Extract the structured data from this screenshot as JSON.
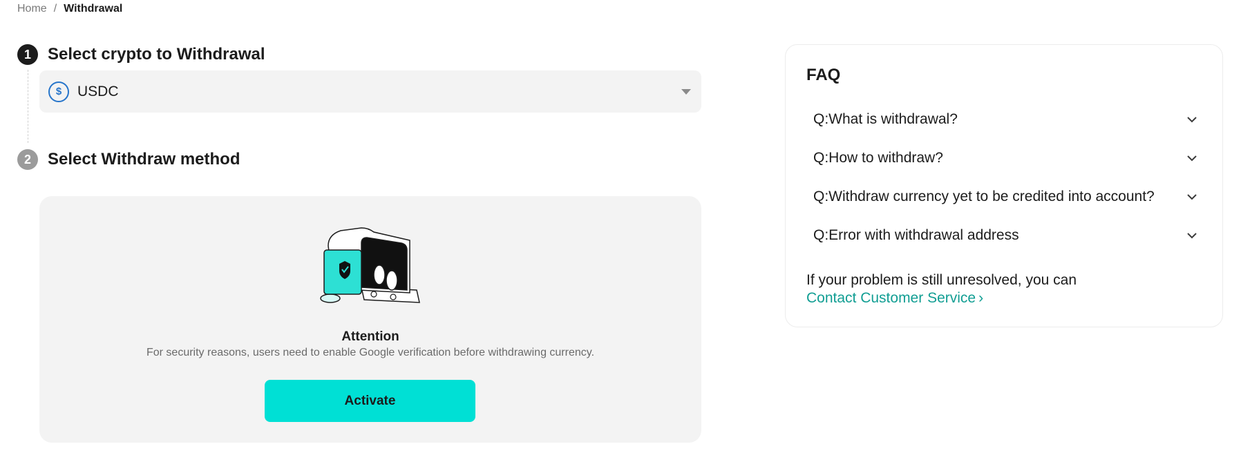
{
  "breadcrumb": {
    "home": "Home",
    "separator": "/",
    "current": "Withdrawal"
  },
  "steps": [
    {
      "number": "1",
      "title": "Select crypto to Withdrawal"
    },
    {
      "number": "2",
      "title": "Select Withdraw method"
    }
  ],
  "crypto_select": {
    "selected": "USDC",
    "coin_icon": "usdc-coin-icon",
    "coin_symbol": "$"
  },
  "method": {
    "illustration": "safe-illustration",
    "attention_title": "Attention",
    "attention_desc": "For security reasons, users need to enable Google verification before withdrawing currency.",
    "activate_label": "Activate"
  },
  "faq": {
    "title": "FAQ",
    "items": [
      "Q:What is withdrawal?",
      "Q:How to withdraw?",
      "Q:Withdraw currency yet to be credited into account?",
      "Q:Error with withdrawal address"
    ],
    "note": "If your problem is still unresolved, you can",
    "link": "Contact Customer Service",
    "link_arrow": "›"
  },
  "colors": {
    "accent": "#00e0d5",
    "link": "#119e93",
    "usdc": "#2775ca"
  }
}
